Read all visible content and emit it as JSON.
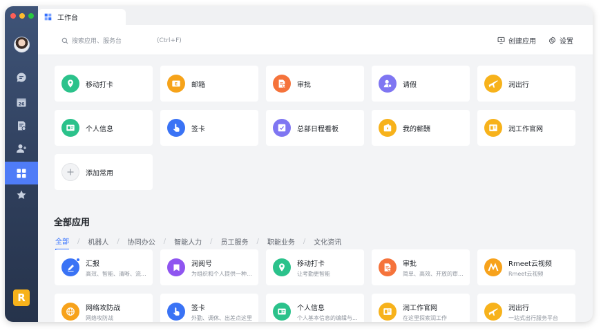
{
  "window": {
    "tab_title": "工作台"
  },
  "header": {
    "search_placeholder": "搜索应用、服务台",
    "search_shortcut": "(Ctrl+F)",
    "create_app_label": "创建应用",
    "settings_label": "设置"
  },
  "colors": {
    "accent": "#3370ff",
    "sidebar": "#34466a",
    "active_nav": "#4f7cf7"
  },
  "sidebar": {
    "items": [
      {
        "icon": "chat-icon"
      },
      {
        "icon": "calendar-icon",
        "label": "26"
      },
      {
        "icon": "approval-doc-icon"
      },
      {
        "icon": "contacts-icon"
      },
      {
        "icon": "workbench-grid-icon",
        "active": true
      },
      {
        "icon": "star-icon"
      }
    ],
    "logo_letter": "R"
  },
  "common_apps": [
    {
      "label": "移动打卡",
      "color": "#2bc28b",
      "icon": "location-pin-icon"
    },
    {
      "label": "邮箱",
      "color": "#f6a31a",
      "icon": "mail-icon"
    },
    {
      "label": "审批",
      "color": "#f5733b",
      "icon": "approval-icon"
    },
    {
      "label": "请假",
      "color": "#7f76f2",
      "icon": "leave-icon"
    },
    {
      "label": "润出行",
      "color": "#f7b21b",
      "icon": "plane-icon"
    },
    {
      "label": "个人信息",
      "color": "#2bc28b",
      "icon": "id-card-icon"
    },
    {
      "label": "签卡",
      "color": "#3a73f5",
      "icon": "tap-hand-icon"
    },
    {
      "label": "总部日程看板",
      "color": "#7f76f2",
      "icon": "checklist-icon"
    },
    {
      "label": "我的薪酬",
      "color": "#f7b21b",
      "icon": "wallet-icon"
    },
    {
      "label": "润工作官网",
      "color": "#f7b21b",
      "icon": "website-icon"
    },
    {
      "label": "添加常用",
      "color": "#f2f3f5",
      "icon": "plus-icon"
    }
  ],
  "all_apps": {
    "title": "全部应用",
    "filters": [
      "全部",
      "机器人",
      "协同办公",
      "智能人力",
      "员工服务",
      "职能业务",
      "文化资讯"
    ],
    "active_filter": "全部",
    "items": [
      {
        "label": "汇报",
        "desc": "高效、智能、清晰、流...",
        "color": "#3a73f5",
        "icon": "pen-icon",
        "badge": true
      },
      {
        "label": "润阅号",
        "desc": "为组织和个人提供一种...",
        "color": "#8f55f0",
        "icon": "article-icon"
      },
      {
        "label": "移动打卡",
        "desc": "让考勤更智能",
        "color": "#2bc28b",
        "icon": "location-pin-icon"
      },
      {
        "label": "审批",
        "desc": "简单、高效、开放的审...",
        "color": "#f5733b",
        "icon": "approval-icon"
      },
      {
        "label": "Rmeet云视频",
        "desc": "Rmeet云视频",
        "color": "#f7a21b",
        "icon": "video-meeting-icon"
      },
      {
        "label": "网络攻防战",
        "desc": "网络攻防战",
        "color": "#f7a21b",
        "icon": "globe-icon"
      },
      {
        "label": "签卡",
        "desc": "外勤、调休、出差点这里",
        "color": "#3a73f5",
        "icon": "tap-hand-icon"
      },
      {
        "label": "个人信息",
        "desc": "个人基本信息的编辑与...",
        "color": "#2bc28b",
        "icon": "id-card-icon"
      },
      {
        "label": "润工作官网",
        "desc": "在这里探索润工作",
        "color": "#f7b21b",
        "icon": "website-icon"
      },
      {
        "label": "润出行",
        "desc": "一站式出行服务平台",
        "color": "#f7b21b",
        "icon": "plane-icon"
      }
    ]
  }
}
